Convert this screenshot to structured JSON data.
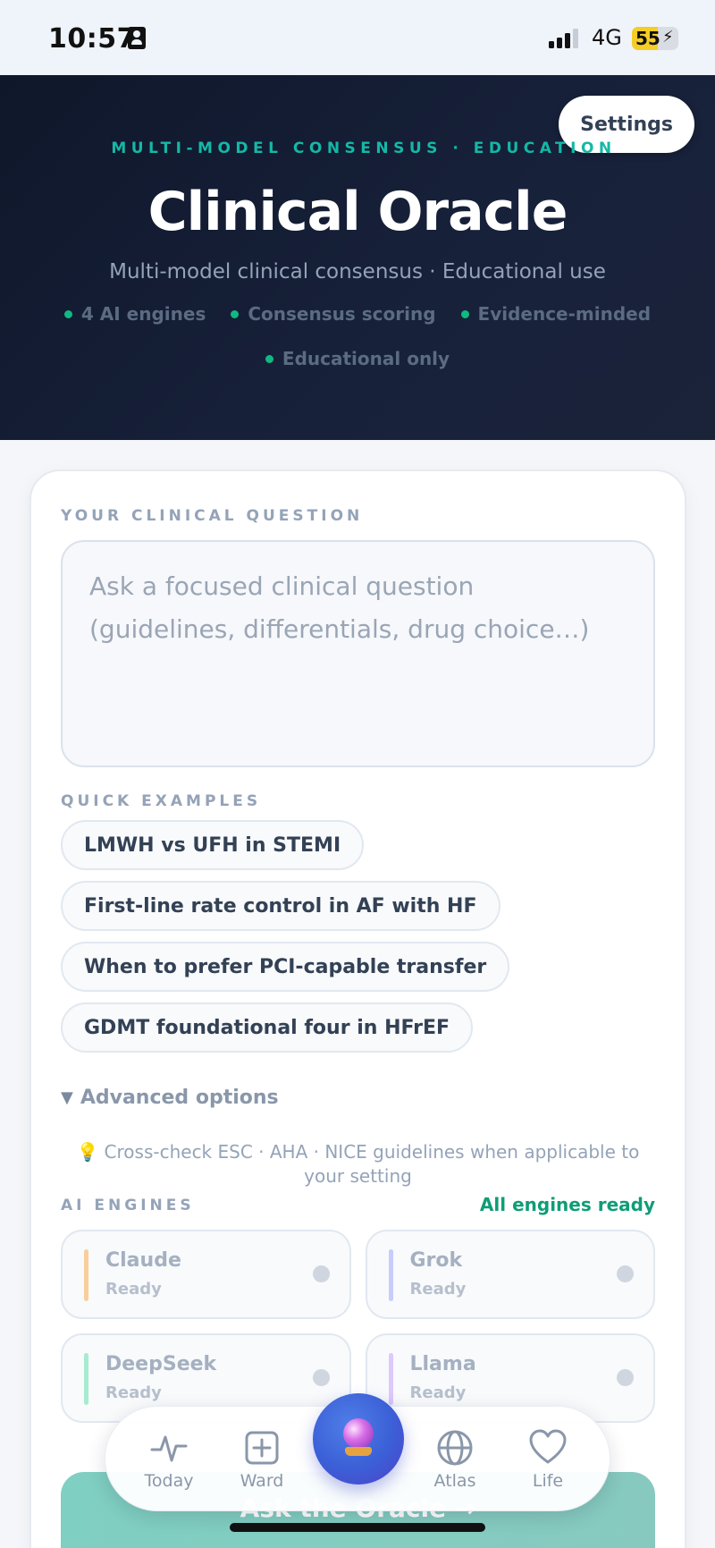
{
  "status_bar": {
    "time": "10:57",
    "network": "4G",
    "battery": "55"
  },
  "header": {
    "settings_label": "Settings",
    "kicker": "MULTI-MODEL CONSENSUS · EDUCATION",
    "title": "Clinical Oracle",
    "subtitle": "Multi-model clinical consensus · Educational use",
    "chips": [
      "4 AI engines",
      "Consensus scoring",
      "Evidence-minded",
      "Educational only"
    ]
  },
  "question": {
    "label": "YOUR CLINICAL QUESTION",
    "value": "",
    "placeholder": "Ask a focused clinical question (guidelines, differentials, drug choice…)"
  },
  "examples": {
    "label": "QUICK EXAMPLES",
    "items": [
      "LMWH vs UFH in STEMI",
      "First-line rate control in AF with HF",
      "When to prefer PCI-capable transfer",
      "GDMT foundational four in HFrEF"
    ]
  },
  "advanced": {
    "label": "Advanced options",
    "icon": "caret-down-icon"
  },
  "tip": {
    "icon": "lightbulb-icon",
    "text": "Cross-check ESC · AHA · NICE guidelines when applicable to your setting"
  },
  "engines": {
    "label": "AI ENGINES",
    "status": "All engines ready",
    "items": [
      {
        "name": "Claude",
        "status": "Ready",
        "color": "#f7cf9c"
      },
      {
        "name": "Grok",
        "status": "Ready",
        "color": "#c7cdfb"
      },
      {
        "name": "DeepSeek",
        "status": "Ready",
        "color": "#a7ecd0"
      },
      {
        "name": "Llama",
        "status": "Ready",
        "color": "#ddc9fb"
      }
    ]
  },
  "ask_button": {
    "label": "Ask the Oracle →"
  },
  "nav": {
    "items": [
      {
        "label": "Today",
        "icon": "activity-icon"
      },
      {
        "label": "Ward",
        "icon": "plus-square-icon"
      },
      {
        "label": "",
        "icon": "crystal-ball-icon"
      },
      {
        "label": "Atlas",
        "icon": "globe-icon"
      },
      {
        "label": "Life",
        "icon": "heart-icon"
      }
    ]
  },
  "colors": {
    "accent_teal": "#14b8a6",
    "hero_bg": "#0f172a",
    "ready_green": "#0f9d76"
  }
}
